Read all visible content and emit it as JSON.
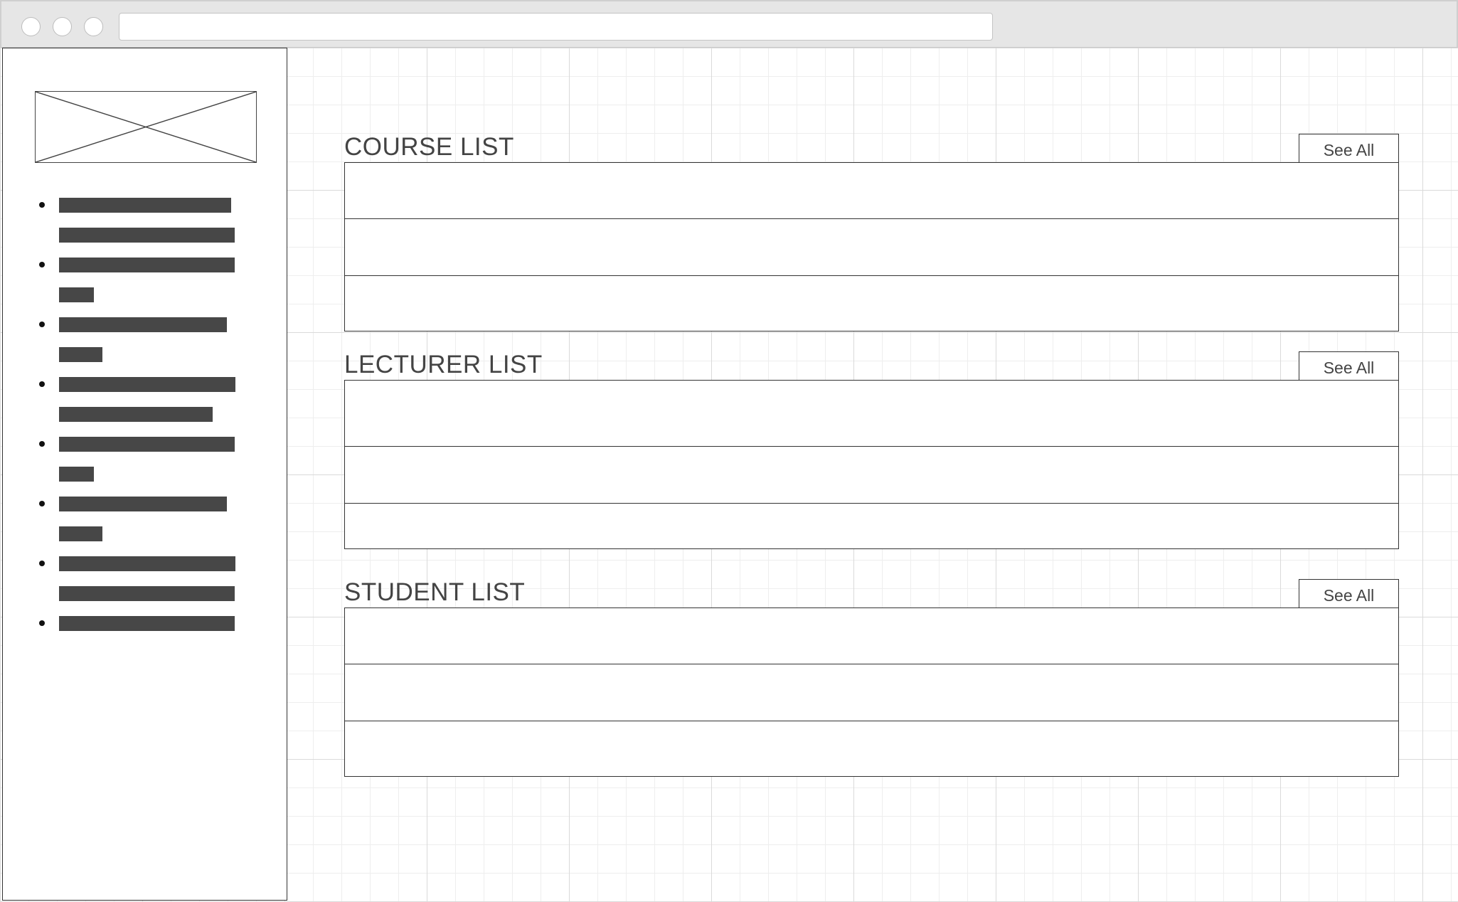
{
  "window": {
    "address_bar": ""
  },
  "sidebar": {
    "logo": "image-placeholder-icon",
    "nav_item_count": 8
  },
  "sections": [
    {
      "title": "COURSE LIST",
      "see_all_label": "See All"
    },
    {
      "title": "LECTURER LIST",
      "see_all_label": "See All"
    },
    {
      "title": "STUDENT LIST",
      "see_all_label": "See All"
    }
  ],
  "colors": {
    "line": "#333333",
    "text": "#444444",
    "placeholder_bar": "#474747",
    "chrome": "#e6e6e6"
  }
}
